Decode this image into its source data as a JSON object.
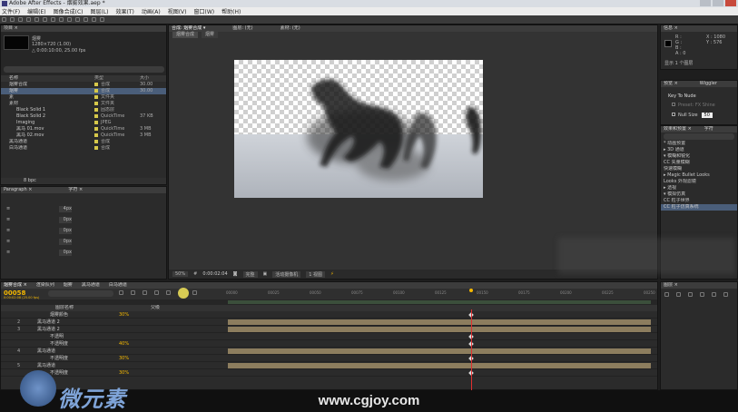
{
  "window": {
    "title": "Adobe After Effects - 烟雾效果.aep *"
  },
  "menu": [
    "文件(F)",
    "编辑(E)",
    "图像合成(C)",
    "图层(L)",
    "效果(T)",
    "动画(A)",
    "视图(V)",
    "窗口(W)",
    "帮助(H)"
  ],
  "project": {
    "tab": "项目 ×",
    "comp_name": "烟雾",
    "comp_info": "1280×720 (1.00)",
    "comp_info2": "△ 0:00:10:00, 25.00 fps",
    "columns": [
      "名称",
      "类型",
      "大小"
    ],
    "items": [
      {
        "name": "烟雾合成",
        "type": "合成",
        "size": "30.00"
      },
      {
        "name": "烟雾",
        "type": "合成",
        "size": "30.00"
      },
      {
        "name": "素",
        "type": "文件夹",
        "size": ""
      },
      {
        "name": "素材",
        "type": "文件夹",
        "size": ""
      },
      {
        "name": "Black Solid 1",
        "type": "固态层",
        "size": ""
      },
      {
        "name": "Black Solid 2",
        "type": "QuickTime",
        "size": "37 KB"
      },
      {
        "name": "Imaging",
        "type": "JPEG",
        "size": ""
      },
      {
        "name": "黑马 01.mov",
        "type": "QuickTime",
        "size": "3 MB"
      },
      {
        "name": "黑马 02.mov",
        "type": "QuickTime",
        "size": "3 MB"
      },
      {
        "name": "黑马通道",
        "type": "合成",
        "size": ""
      },
      {
        "name": "白马通道",
        "type": "合成",
        "size": ""
      }
    ],
    "bpc": "8 bpc"
  },
  "effects_controls": {
    "tab": "Paragraph ×",
    "sub": "字符 ×",
    "labels": [
      "4px",
      "0px",
      "0px",
      "0px",
      "0px"
    ]
  },
  "viewer": {
    "tab": "合成: 烟雾合成 ▾",
    "tab2": "图层: (无)",
    "tab3": "素材: (无)",
    "crumbs": [
      "烟雾合成",
      "烟雾"
    ],
    "zoom": "50%",
    "timecode": "0:00:02:04",
    "quality": "完整",
    "camera": "活动摄像机",
    "view": "1 视图"
  },
  "right": {
    "info_tab": "信息 ×",
    "info_vals": [
      "R :",
      "G :",
      "B :",
      "A : 0"
    ],
    "info_xy": [
      "X : 1080",
      "Y : 576"
    ],
    "info_note": "显示 1 个图层",
    "preview_tab": "预览 ×",
    "preview_tab2": "Wiggler",
    "fx_panel_title": "Key To Nude",
    "fx_item1": "Preset: FX Shine",
    "fx_item2": "Null Size",
    "fx_item2_val": "50",
    "effects_tab": "效果和预置 ×",
    "effects_tab2": "字符",
    "effects_items": [
      "* 动画预置",
      "▸ 3D 通道",
      "▾ 模糊和锐化",
      "  CC 矢量模糊",
      "  快速模糊",
      "▸ Magic Bullet Looks",
      "  Looks 外观滤镜",
      "▸ 透视",
      "▾ 模拟仿真",
      "  CC 粒子世界",
      "  CC 粒子仿真系统"
    ]
  },
  "timeline": {
    "tab": "烟雾合成 ×",
    "tabs": [
      "渲染队列",
      "烟雾",
      "黑马通道",
      "白马通道"
    ],
    "timecode": "00058",
    "timecode_sub": "0:00:02:08 (25.00 fps)",
    "search_placeholder": "",
    "columns": [
      "图层名称",
      "父级"
    ],
    "ruler": [
      "00000",
      "00025",
      "00050",
      "00075",
      "00100",
      "00125",
      "00150",
      "00175",
      "00200",
      "00225",
      "00250"
    ],
    "layers": [
      {
        "n": "",
        "name": "烟雾颜色",
        "value": "30%"
      },
      {
        "n": "2",
        "name": "黑马通道 2",
        "value": ""
      },
      {
        "n": "3",
        "name": "黑马通道 2",
        "value": ""
      },
      {
        "n": "",
        "name": "不透明",
        "value": ""
      },
      {
        "n": "",
        "name": "不透明度",
        "value": "40%"
      },
      {
        "n": "4",
        "name": "黑马通道",
        "value": ""
      },
      {
        "n": "",
        "name": "不透明度",
        "value": "30%"
      },
      {
        "n": "5",
        "name": "黑马通道",
        "value": ""
      },
      {
        "n": "",
        "name": "不透明度",
        "value": "30%"
      }
    ],
    "right_tab": "图层 ×"
  },
  "footer": {
    "site": "www.cgjoy.com",
    "logo": "微元素"
  },
  "colors": {
    "bg": "#1e1e1e",
    "panel": "#2b2b2b",
    "accent": "#f5b800",
    "playhead": "#e03030"
  }
}
